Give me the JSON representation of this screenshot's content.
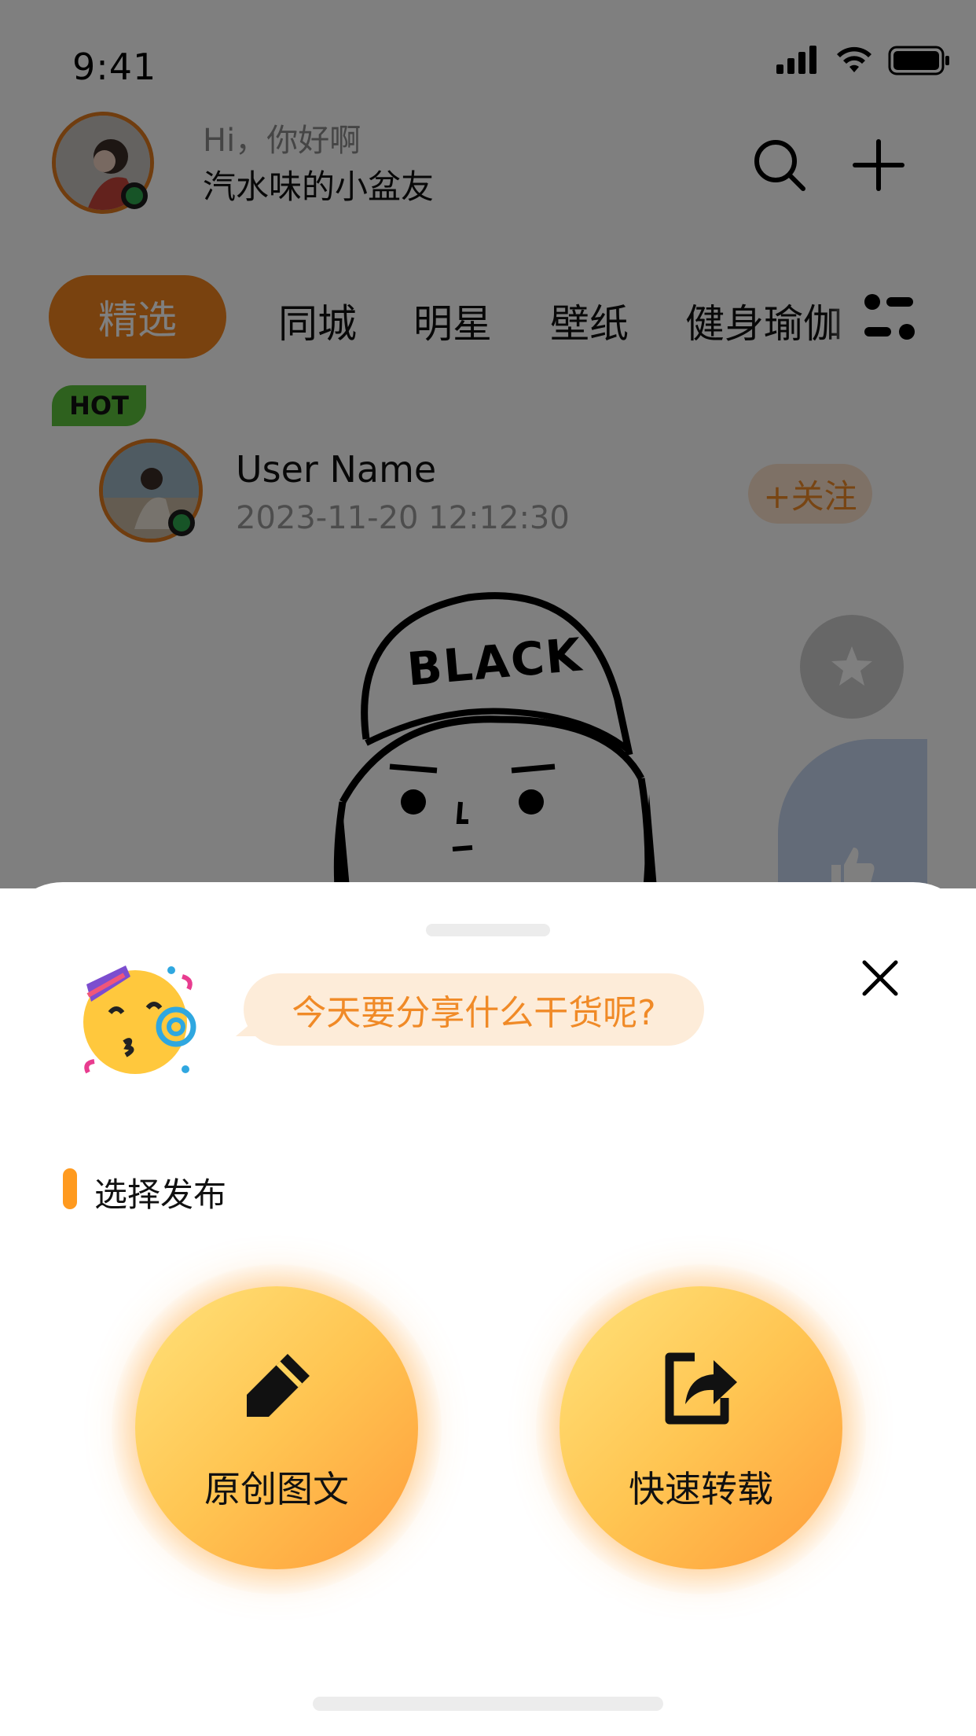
{
  "status_bar": {
    "time": "9:41"
  },
  "header": {
    "greeting": "Hi，你好啊",
    "username": "汽水味的小盆友",
    "search_icon": "search-icon",
    "add_icon": "plus-icon"
  },
  "tabs": {
    "items": [
      {
        "label": "精选",
        "active": true
      },
      {
        "label": "同城"
      },
      {
        "label": "明星"
      },
      {
        "label": "壁纸"
      },
      {
        "label": "健身瑜伽"
      }
    ],
    "filter_icon": "filter-icon"
  },
  "post": {
    "badge": "HOT",
    "user_name": "User Name",
    "date": "2023-11-20  12:12:30",
    "follow_label": "+关注",
    "image_text": "BLACK"
  },
  "sheet": {
    "prompt": "今天要分享什么干货呢?",
    "section_title": "选择发布",
    "options": [
      {
        "label": "原创图文",
        "icon": "pencil-icon"
      },
      {
        "label": "快速转载",
        "icon": "share-icon"
      }
    ]
  },
  "colors": {
    "accent": "#f2851f",
    "hot_badge": "#5cc23c",
    "online": "#2fa84f",
    "follow_bg": "#fde3cc"
  }
}
